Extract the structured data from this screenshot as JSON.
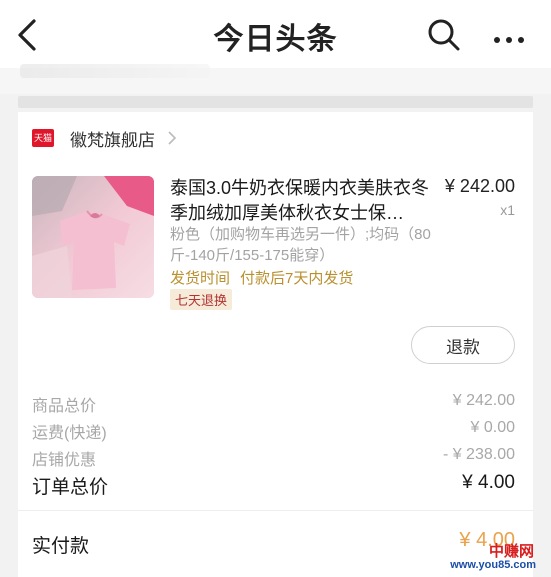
{
  "header": {
    "title": "今日头条",
    "back_icon": "chevron-left-icon",
    "search_icon": "search-icon",
    "more_icon": "more-dots-icon"
  },
  "store": {
    "badge": "天猫",
    "name": "徽梵旗舰店",
    "badge_color": "#e0162b"
  },
  "product": {
    "title": "泰国3.0牛奶衣保暖内衣美肤衣冬季加绒加厚美体秋衣女士保…",
    "price": "¥ 242.00",
    "quantity": "x1",
    "variant": "粉色（加购物车再选另一件）;均码（80斤-140斤/155-175能穿）",
    "shipping_label": "发货时间",
    "shipping_value": "付款后7天内发货",
    "return_policy": "七天退换",
    "refund_button": "退款"
  },
  "summary": {
    "goods_total_label": "商品总价",
    "goods_total_value": "¥ 242.00",
    "shipping_fee_label": "运费(快递)",
    "shipping_fee_value": "¥ 0.00",
    "store_discount_label": "店铺优惠",
    "store_discount_value": "- ¥ 238.00",
    "order_total_label": "订单总价",
    "order_total_value": "¥ 4.00",
    "paid_label": "实付款",
    "paid_value": "¥ 4.00"
  },
  "watermark": {
    "brand": "中赚网",
    "url": "www.you85.com"
  },
  "colors": {
    "accent_orange": "#e58b1f",
    "shipping_gold": "#b9902e",
    "return_red": "#b03434"
  }
}
